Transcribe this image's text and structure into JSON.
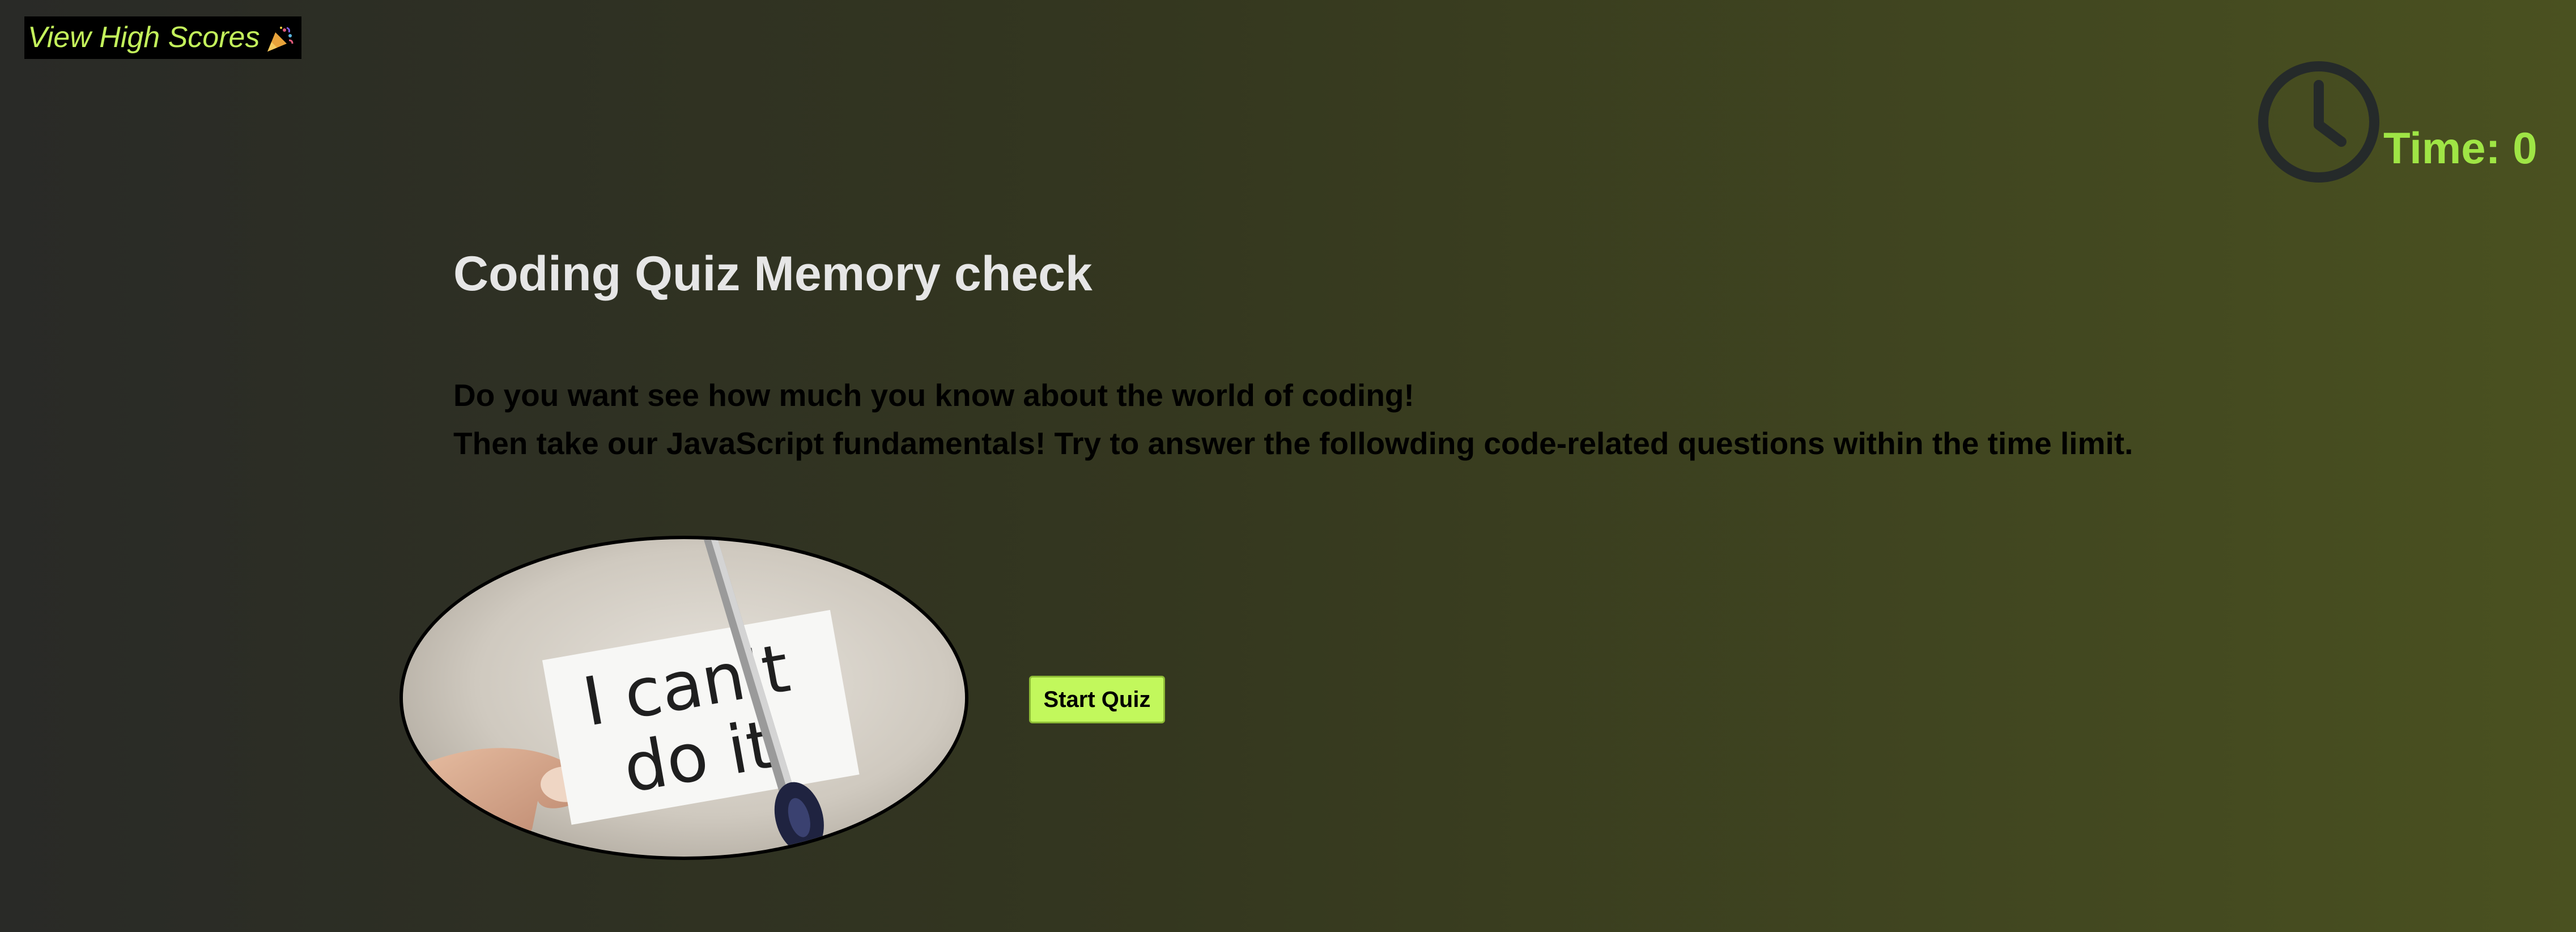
{
  "header": {
    "high_scores_label": "View High Scores",
    "high_scores_icon": "party-popper-icon"
  },
  "timer": {
    "icon": "clock-icon",
    "label": "Time: 0"
  },
  "main": {
    "title": "Coding Quiz Memory check",
    "description_line1": "Do you want see how much you know about the world of coding!",
    "description_line2": "Then take our JavaScript fundamentals! Try to answer the followding code-related questions within the time limit.",
    "start_button_label": "Start Quiz"
  },
  "hero_image": {
    "card_line1": "I can't",
    "card_line2": "do it"
  },
  "colors": {
    "accent": "#c2f85c",
    "timer_text": "#9fe545",
    "title_text": "#e6e6e6",
    "clock": "#252a2a"
  }
}
